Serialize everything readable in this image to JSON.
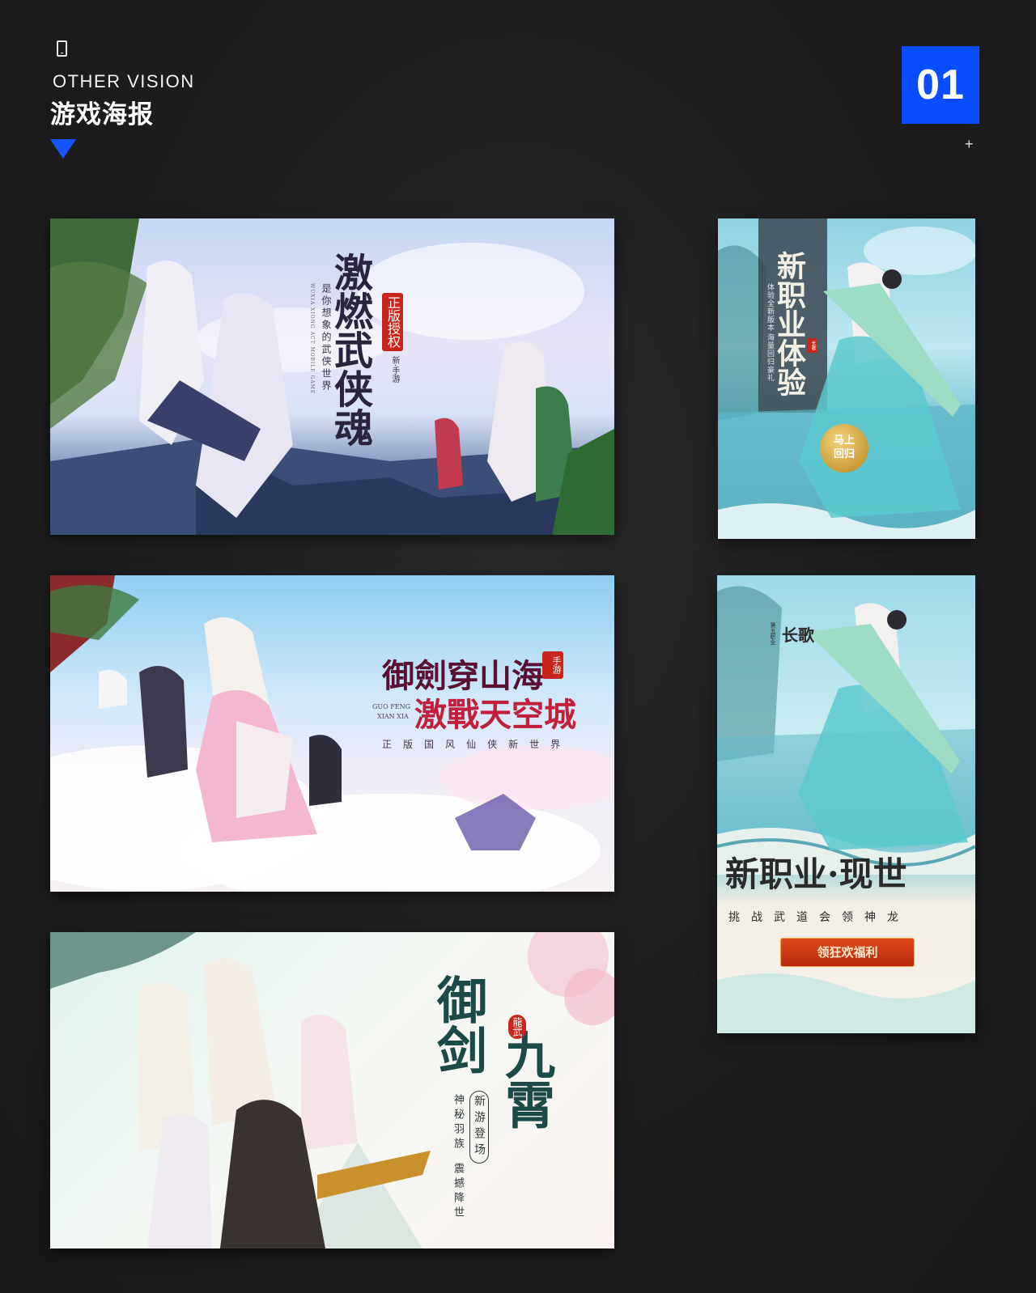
{
  "header": {
    "subtitle_en": "OTHER VISION",
    "title_cn": "游戏海报",
    "section_number": "01",
    "plus_mark": "+"
  },
  "posters": [
    {
      "title_lines": [
        "激",
        "燃",
        "武",
        "侠",
        "魂"
      ],
      "seal": "正版授权",
      "subtitle": "是你想象的武侠世界",
      "english": "WUXIA XIONG ACT MOBILE GAME",
      "tag": "新·手游"
    },
    {
      "title_line1": "御劍穿山海",
      "title_line2": "激戰天空城",
      "badge": "手游",
      "english_line1": "GUO FENG",
      "english_line2": "XIAN XIA",
      "slogan": [
        "正",
        "版",
        "国",
        "风",
        "仙",
        "侠",
        "新",
        "世",
        "界"
      ]
    },
    {
      "title_chars": [
        "御",
        "剑",
        "九",
        "霄"
      ],
      "seal": "龍武",
      "circle_text": [
        "新",
        "游",
        "登",
        "场"
      ],
      "slogan_top": "神秘羽族",
      "slogan_bottom": "震撼降世"
    },
    {
      "title": "新职业体验",
      "side_left": "体验全新版本",
      "side_right": "海量回归豪礼",
      "stamp": "长歌",
      "button": "马上回归"
    },
    {
      "logo": "长歌",
      "logo_note": "第五职业",
      "title": "新职业·现世",
      "slogan": [
        "挑",
        "战",
        "武",
        "道",
        "会",
        "领",
        "神",
        "龙"
      ],
      "button": "领狂欢福利"
    }
  ],
  "colors": {
    "accent_blue": "#0a4dff",
    "background": "#1d1d1f",
    "seal_red": "#c8261c"
  }
}
